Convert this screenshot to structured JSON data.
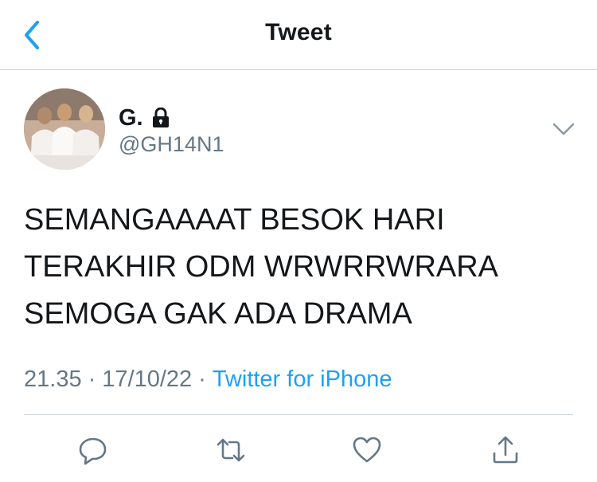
{
  "header": {
    "title": "Tweet",
    "back_icon": "chevron-left-icon",
    "accent_color": "#1da1f2"
  },
  "tweet": {
    "author": {
      "display_name": "G.",
      "handle": "@GH14N1",
      "protected": true,
      "lock_icon": "lock-icon"
    },
    "text_lines": [
      "SEMANGAAAAT BESOK HARI",
      "TERAKHIR ODM WRWRRWRARA",
      "SEMOGA GAK ADA DRAMA"
    ],
    "time": "21.35",
    "date": "17/10/22",
    "separator": "·",
    "source": "Twitter for iPhone",
    "more_icon": "chevron-down-icon"
  },
  "actions": [
    {
      "name": "reply",
      "icon": "reply-icon"
    },
    {
      "name": "retweet",
      "icon": "retweet-icon"
    },
    {
      "name": "like",
      "icon": "heart-icon"
    },
    {
      "name": "share",
      "icon": "share-icon"
    }
  ],
  "colors": {
    "text": "#14171a",
    "secondary": "#657786",
    "link": "#1da1f2",
    "divider": "#cfd6dc"
  }
}
